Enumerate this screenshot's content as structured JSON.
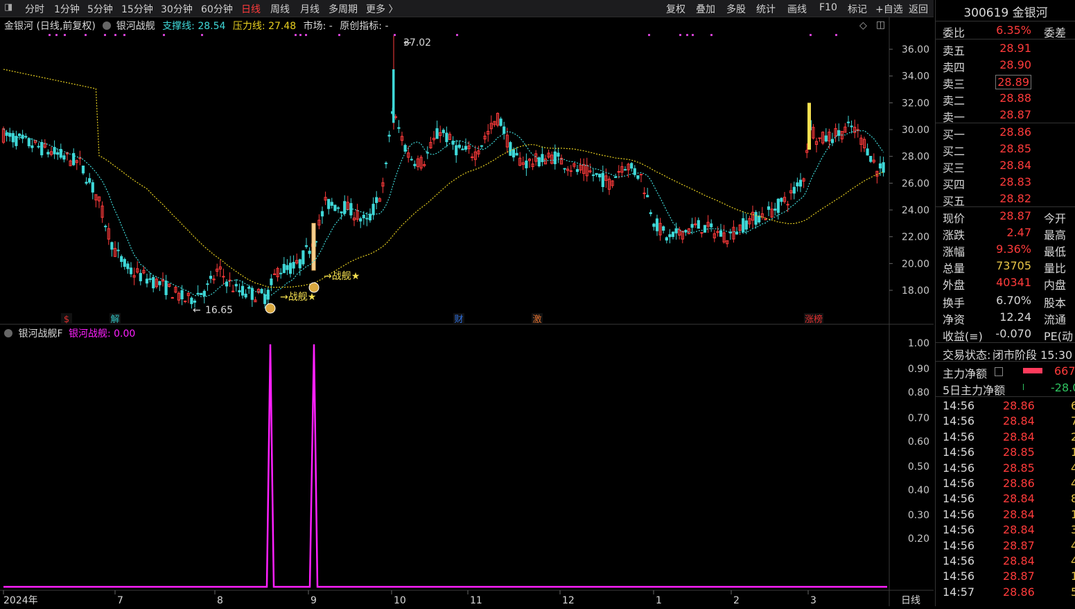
{
  "toolbar": {
    "left_items": [
      {
        "label": "分时",
        "active": false
      },
      {
        "label": "1分钟",
        "active": false
      },
      {
        "label": "5分钟",
        "active": false
      },
      {
        "label": "15分钟",
        "active": false
      },
      {
        "label": "30分钟",
        "active": false
      },
      {
        "label": "60分钟",
        "active": false
      },
      {
        "label": "日线",
        "active": true
      },
      {
        "label": "周线",
        "active": false
      },
      {
        "label": "月线",
        "active": false
      },
      {
        "label": "多周期",
        "active": false
      },
      {
        "label": "更多 〉",
        "active": false
      }
    ],
    "right_items": [
      "复权",
      "叠加",
      "多股",
      "统计",
      "画线",
      "F10",
      "标记",
      "+自选",
      "返回"
    ]
  },
  "main_chart": {
    "stock_title": "金银河 (日线,前复权)",
    "indicator_name": "银河战舰",
    "support_label": "支撑线:",
    "support_value": "28.54",
    "pressure_label": "压力线:",
    "pressure_value": "27.48",
    "market_label": "市场: -",
    "original_indicator_label": "原创指标: -",
    "y_ticks": [
      "36.00",
      "34.00",
      "32.00",
      "30.00",
      "28.00",
      "26.00",
      "24.00",
      "22.00",
      "20.00",
      "18.00"
    ],
    "high_marker": "37.02",
    "low_marker": "16.65",
    "signal_labels": [
      "战舰★",
      "战舰★"
    ],
    "event_tags": [
      {
        "text": "$",
        "color": "#e03030"
      },
      {
        "text": "解",
        "color": "#30c0c0"
      },
      {
        "text": "财",
        "color": "#3070e0"
      },
      {
        "text": "激",
        "color": "#e07030"
      },
      {
        "text": "涨榜",
        "color": "#e03030"
      }
    ]
  },
  "sub_chart": {
    "name": "银河战舰F",
    "series_label": "银河战舰: 0.00",
    "y_ticks": [
      "1.00",
      "0.90",
      "0.80",
      "0.70",
      "0.60",
      "0.50",
      "0.40",
      "0.30",
      "0.20"
    ]
  },
  "x_axis": {
    "labels": [
      "2024年",
      "7",
      "8",
      "9",
      "10",
      "11",
      "12",
      "1",
      "2",
      "3"
    ],
    "period_label": "日线"
  },
  "quote_panel": {
    "title": "300619 金银河",
    "weibi_label": "委比",
    "weibi_value": "6.35%",
    "weicha_label": "委差",
    "asks": [
      {
        "label": "卖五",
        "price": "28.91"
      },
      {
        "label": "卖四",
        "price": "28.90"
      },
      {
        "label": "卖三",
        "price": "28.89"
      },
      {
        "label": "卖二",
        "price": "28.88"
      },
      {
        "label": "卖一",
        "price": "28.87"
      }
    ],
    "bids": [
      {
        "label": "买一",
        "price": "28.86"
      },
      {
        "label": "买二",
        "price": "28.85"
      },
      {
        "label": "买三",
        "price": "28.84"
      },
      {
        "label": "买四",
        "price": "28.83"
      },
      {
        "label": "买五",
        "price": "28.82"
      }
    ],
    "stats": [
      {
        "label": "现价",
        "value": "28.87",
        "color": "#ff3b3b",
        "right": "今开"
      },
      {
        "label": "涨跌",
        "value": "2.47",
        "color": "#ff3b3b",
        "right": "最高"
      },
      {
        "label": "涨幅",
        "value": "9.36%",
        "color": "#ff3b3b",
        "right": "最低"
      },
      {
        "label": "总量",
        "value": "73705",
        "color": "#e8c547",
        "right": "量比"
      },
      {
        "label": "外盘",
        "value": "40341",
        "color": "#ff3b3b",
        "right": "内盘"
      },
      {
        "label": "换手",
        "value": "6.70%",
        "color": "#d8d8d8",
        "right": "股本"
      },
      {
        "label": "净资",
        "value": "12.24",
        "color": "#d8d8d8",
        "right": "流通"
      },
      {
        "label": "收益(≡)",
        "value": "-0.070",
        "color": "#d8d8d8",
        "right": "PE(动"
      }
    ],
    "trade_status_label": "交易状态:",
    "trade_status_value": "闭市阶段 15:30",
    "main_net_label": "主力净额",
    "main_net_value": "667",
    "five_day_label": "5日主力净额",
    "five_day_value": "-28.0",
    "ticks": [
      {
        "time": "14:56",
        "price": "28.86",
        "vol": "6"
      },
      {
        "time": "14:56",
        "price": "28.84",
        "vol": "7"
      },
      {
        "time": "14:56",
        "price": "28.84",
        "vol": "2"
      },
      {
        "time": "14:56",
        "price": "28.85",
        "vol": "1"
      },
      {
        "time": "14:56",
        "price": "28.85",
        "vol": "4"
      },
      {
        "time": "14:56",
        "price": "28.86",
        "vol": "4"
      },
      {
        "time": "14:56",
        "price": "28.84",
        "vol": "8"
      },
      {
        "time": "14:56",
        "price": "28.84",
        "vol": "1"
      },
      {
        "time": "14:56",
        "price": "28.84",
        "vol": "3"
      },
      {
        "time": "14:56",
        "price": "28.87",
        "vol": "4"
      },
      {
        "time": "14:56",
        "price": "28.84",
        "vol": "4"
      },
      {
        "time": "14:56",
        "price": "28.87",
        "vol": "1"
      },
      {
        "time": "14:57",
        "price": "28.86",
        "vol": "5"
      }
    ]
  },
  "colors": {
    "up": "#ff3b3b",
    "down": "#3fd8d8",
    "ma_short": "#3fd8d8",
    "ma_long": "#e8d020",
    "signal": "#ff20ff",
    "support": "#3fd8d8",
    "pressure": "#e8d020"
  }
}
